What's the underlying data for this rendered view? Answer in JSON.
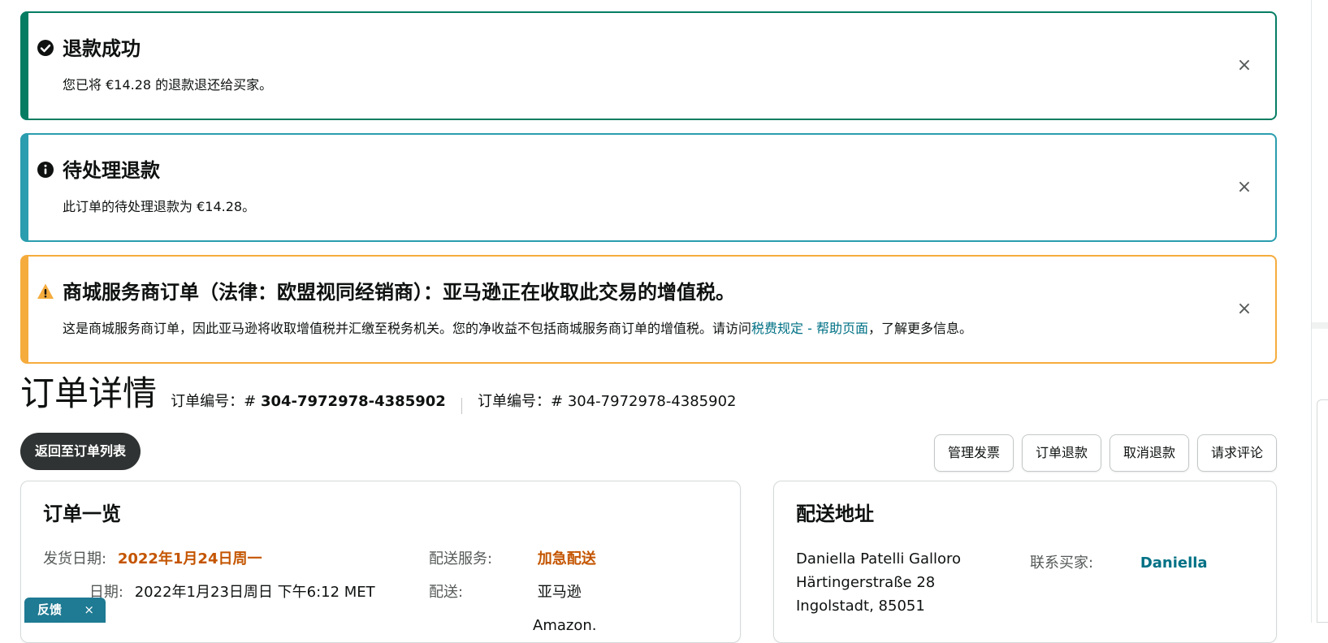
{
  "alerts": {
    "success": {
      "title": "退款成功",
      "body": "您已将 €14.28 的退款退还给买家。",
      "close": "×"
    },
    "info": {
      "title": "待处理退款",
      "body": "此订单的待处理退款为 €14.28。",
      "close": "×"
    },
    "warning": {
      "title": "商城服务商订单（法律：欧盟视同经销商）：亚马逊正在收取此交易的增值税。",
      "body_pre": "这是商城服务商订单，因此亚马逊将收取增值税并汇缴至税务机关。您的净收益不包括商城服务商订单的增值税。请访问",
      "body_link": "税费规定 - 帮助页面",
      "body_post": "，了解更多信息。",
      "close": "×"
    }
  },
  "order": {
    "title": "订单详情",
    "id_label": "订单编号：#",
    "id_value": "304-7972978-4385902",
    "id2_label": "订单编号：#",
    "id2_value": "304-7972978-4385902"
  },
  "buttons": {
    "back": "返回至订单列表",
    "manage_invoice": "管理发票",
    "refund_order": "订单退款",
    "cancel_refund": "取消退款",
    "request_review": "请求评论"
  },
  "summary": {
    "title": "订单一览",
    "ship_date_label": "发货日期:",
    "ship_date_value": "2022年1月24日周一",
    "purchase_date_label": "日期:",
    "purchase_date_value": "2022年1月23日周日 下午6:12 MET",
    "ship_service_label": "配送服务:",
    "ship_service_value": "加急配送",
    "fulfillment_label": "配送:",
    "fulfillment_value": "亚马逊",
    "sales_channel_value": "Amazon."
  },
  "shipping": {
    "title": "配送地址",
    "name": "Daniella Patelli Galloro",
    "street": "Härtingerstraße 28",
    "city": "Ingolstadt, 85051",
    "contact_label": "联系买家:",
    "contact_value": "Daniella"
  },
  "feedback": {
    "label": "反馈",
    "close": "×"
  },
  "colors": {
    "success": "#067d62",
    "info": "#2a9dae",
    "warning": "#f5ac3d",
    "link": "#007185",
    "highlight": "#c45500",
    "feedback": "#1f7a93"
  }
}
